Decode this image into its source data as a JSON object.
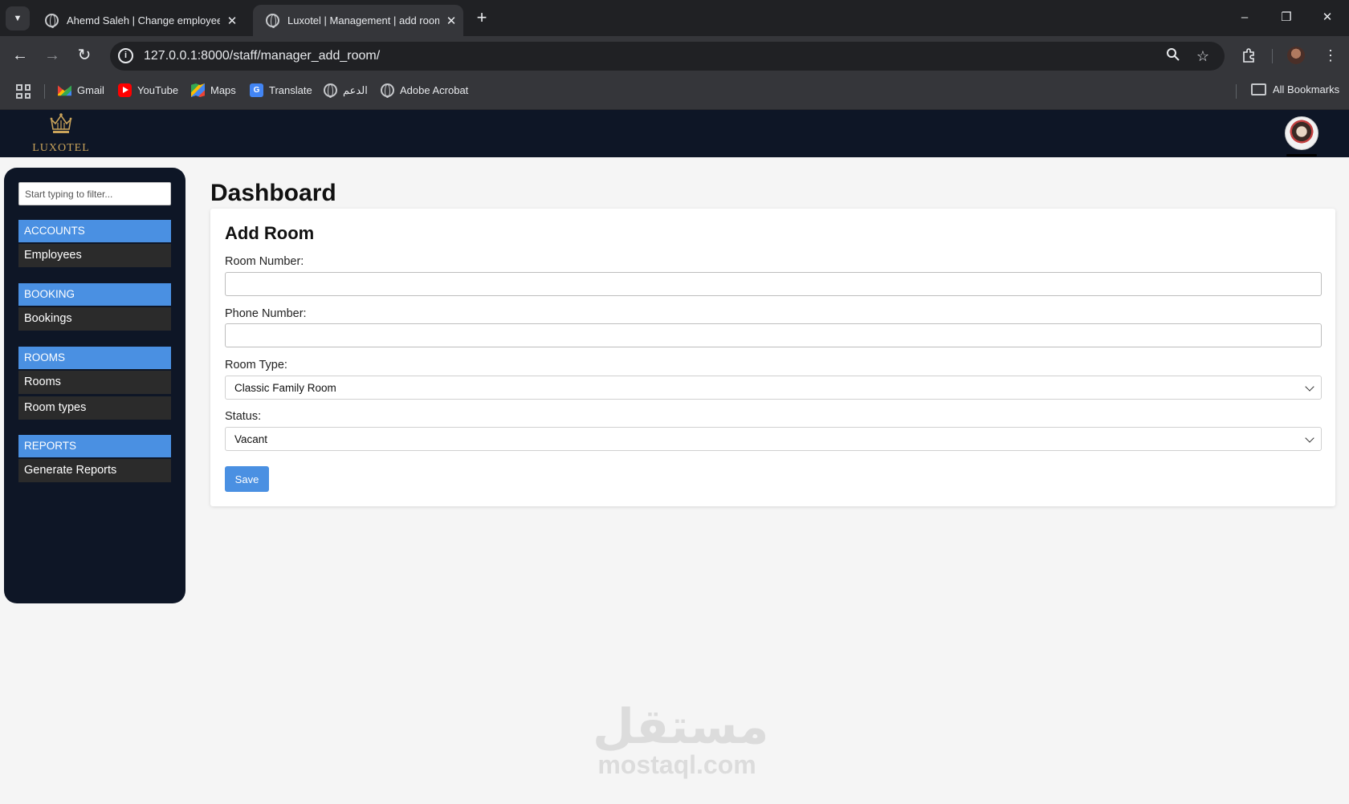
{
  "browser": {
    "tabs": [
      {
        "title": "Ahemd Saleh | Change employee | ...",
        "active": false
      },
      {
        "title": "Luxotel | Management | add room",
        "active": true
      }
    ],
    "url": "127.0.0.1:8000/staff/manager_add_room/",
    "bookmarks": [
      {
        "label": "Gmail",
        "icon": "gmail-icon"
      },
      {
        "label": "YouTube",
        "icon": "youtube-icon"
      },
      {
        "label": "Maps",
        "icon": "maps-icon"
      },
      {
        "label": "Translate",
        "icon": "translate-icon"
      },
      {
        "label": "الدعم",
        "icon": "globe-icon"
      },
      {
        "label": "Adobe Acrobat",
        "icon": "globe-icon"
      }
    ],
    "all_bookmarks_label": "All Bookmarks"
  },
  "header": {
    "logo_text": "LUXOTEL"
  },
  "sidebar": {
    "filter_placeholder": "Start typing to filter...",
    "sections": [
      {
        "title": "ACCOUNTS",
        "items": [
          "Employees"
        ]
      },
      {
        "title": "BOOKING",
        "items": [
          "Bookings"
        ]
      },
      {
        "title": "ROOMS",
        "items": [
          "Rooms",
          "Room types"
        ]
      },
      {
        "title": "REPORTS",
        "items": [
          "Generate Reports"
        ]
      }
    ]
  },
  "main": {
    "page_title": "Dashboard",
    "form": {
      "title": "Add Room",
      "room_number_label": "Room Number:",
      "room_number_value": "",
      "phone_number_label": "Phone Number:",
      "phone_number_value": "",
      "room_type_label": "Room Type:",
      "room_type_selected": "Classic Family Room",
      "status_label": "Status:",
      "status_selected": "Vacant",
      "save_label": "Save"
    }
  },
  "watermark": {
    "arabic": "مستقل",
    "latin": "mostaql.com"
  },
  "colors": {
    "accent": "#4a90e2",
    "sidebar_bg": "#0e1626",
    "header_bg": "#0e1626",
    "sidebar_item_bg": "#2b2b2b",
    "logo_gold": "#c9a35a"
  }
}
